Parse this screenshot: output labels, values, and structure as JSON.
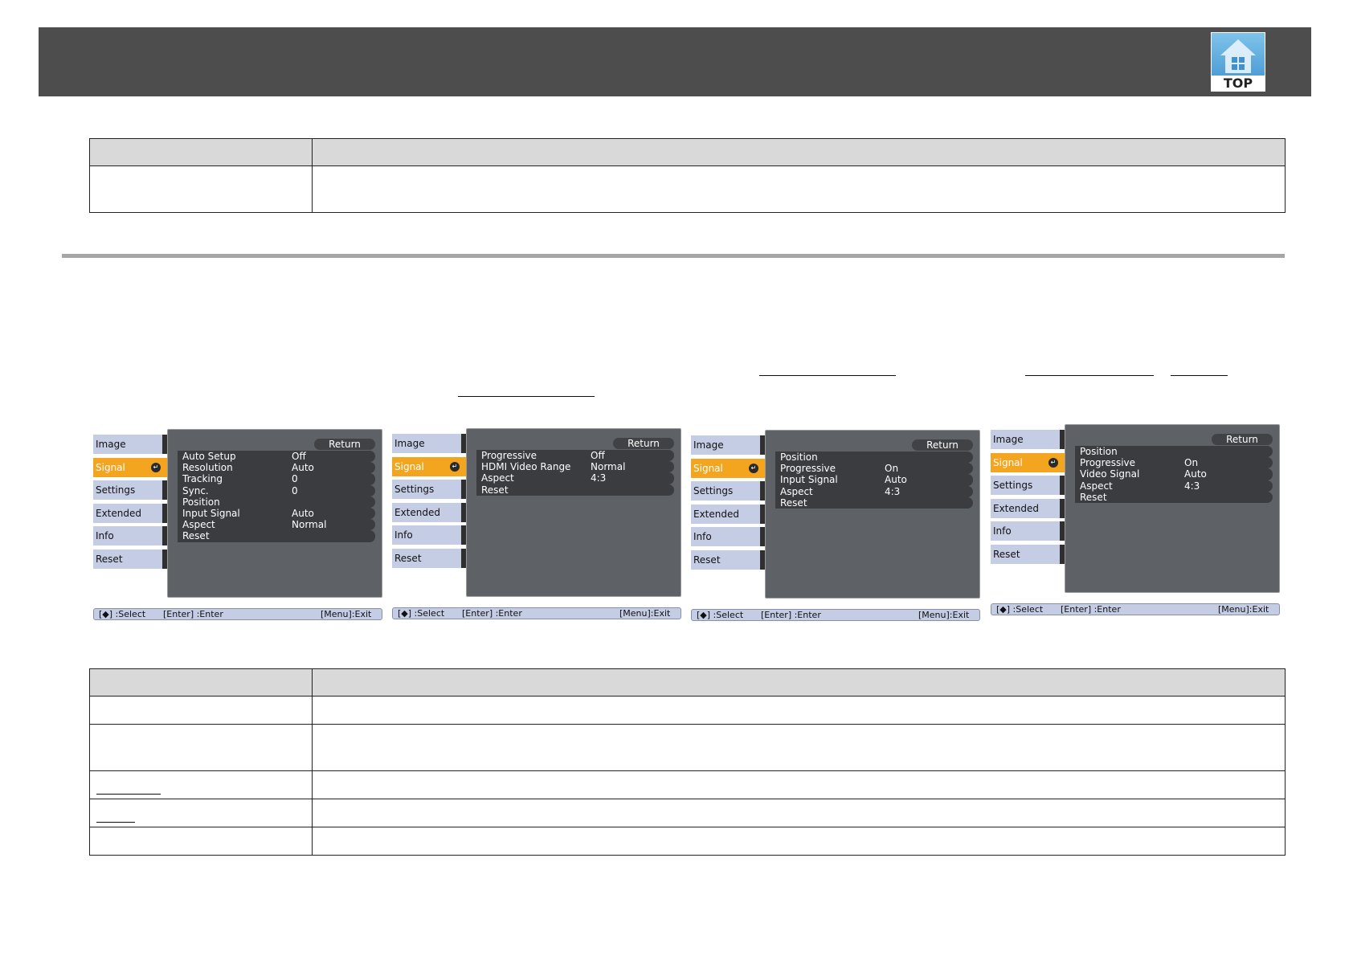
{
  "header": {
    "top_icon_label": "TOP",
    "top_icon": "house-icon"
  },
  "menus": [
    {
      "tabs": [
        "Image",
        "Signal",
        "Settings",
        "Extended",
        "Info",
        "Reset"
      ],
      "active_tab": "Signal",
      "return_label": "Return",
      "items": [
        {
          "label": "Auto Setup",
          "value": "Off"
        },
        {
          "label": "Resolution",
          "value": "Auto"
        },
        {
          "label": "Tracking",
          "value": "0"
        },
        {
          "label": "Sync.",
          "value": "0"
        },
        {
          "label": "Position",
          "value": ""
        },
        {
          "label": "Input Signal",
          "value": "Auto"
        },
        {
          "label": "Aspect",
          "value": "Normal"
        },
        {
          "label": "Reset",
          "value": ""
        }
      ],
      "status": {
        "select": "[◆] :Select",
        "enter": "[Enter] :Enter",
        "exit": "[Menu]:Exit"
      }
    },
    {
      "tabs": [
        "Image",
        "Signal",
        "Settings",
        "Extended",
        "Info",
        "Reset"
      ],
      "active_tab": "Signal",
      "return_label": "Return",
      "items": [
        {
          "label": "Progressive",
          "value": "Off"
        },
        {
          "label": "HDMI Video Range",
          "value": "Normal"
        },
        {
          "label": "Aspect",
          "value": "4:3"
        },
        {
          "label": "Reset",
          "value": ""
        }
      ],
      "status": {
        "select": "[◆] :Select",
        "enter": "[Enter] :Enter",
        "exit": "[Menu]:Exit"
      }
    },
    {
      "tabs": [
        "Image",
        "Signal",
        "Settings",
        "Extended",
        "Info",
        "Reset"
      ],
      "active_tab": "Signal",
      "return_label": "Return",
      "items": [
        {
          "label": "Position",
          "value": ""
        },
        {
          "label": "Progressive",
          "value": "On"
        },
        {
          "label": "Input Signal",
          "value": "Auto"
        },
        {
          "label": "Aspect",
          "value": "4:3"
        },
        {
          "label": "Reset",
          "value": ""
        }
      ],
      "status": {
        "select": "[◆] :Select",
        "enter": "[Enter] :Enter",
        "exit": "[Menu]:Exit"
      }
    },
    {
      "tabs": [
        "Image",
        "Signal",
        "Settings",
        "Extended",
        "Info",
        "Reset"
      ],
      "active_tab": "Signal",
      "return_label": "Return",
      "items": [
        {
          "label": "Position",
          "value": ""
        },
        {
          "label": "Progressive",
          "value": "On"
        },
        {
          "label": "Video Signal",
          "value": "Auto"
        },
        {
          "label": "Aspect",
          "value": "4:3"
        },
        {
          "label": "Reset",
          "value": ""
        }
      ],
      "status": {
        "select": "[◆] :Select",
        "enter": "[Enter] :Enter",
        "exit": "[Menu]:Exit"
      }
    }
  ]
}
